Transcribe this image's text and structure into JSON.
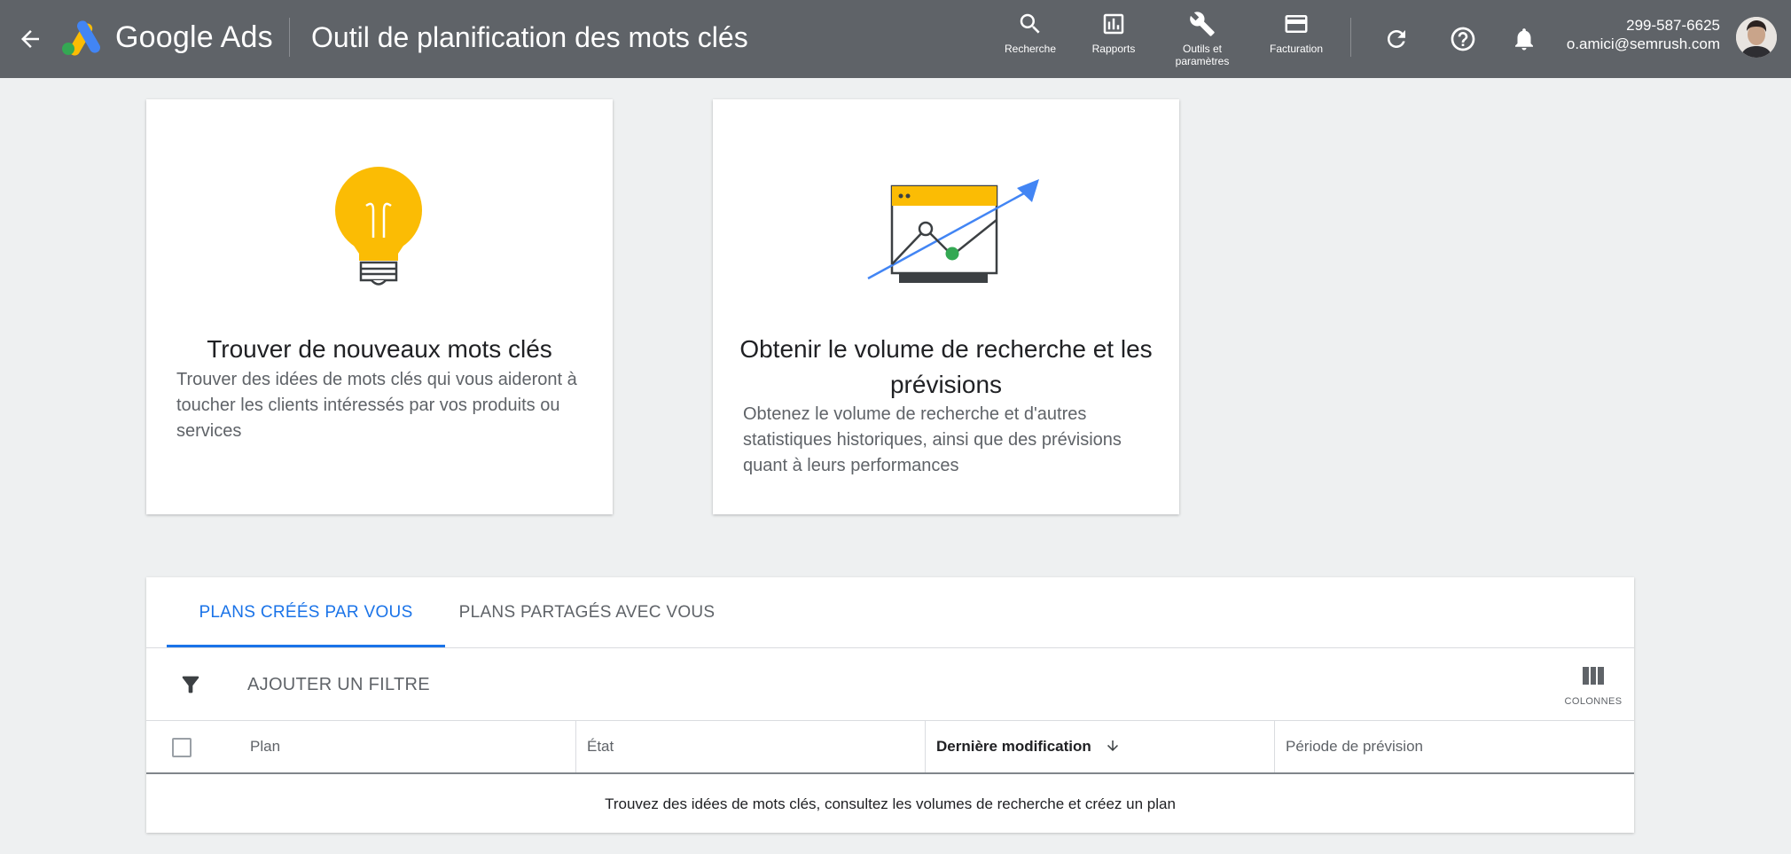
{
  "header": {
    "back_icon": "arrow-back-icon",
    "brand": "Google Ads",
    "title": "Outil de planification des mots clés",
    "nav": [
      {
        "label": "Recherche",
        "icon": "search-icon"
      },
      {
        "label": "Rapports",
        "icon": "reports-icon"
      },
      {
        "label_line1": "Outils et",
        "label_line2": "paramètres",
        "icon": "wrench-icon"
      },
      {
        "label": "Facturation",
        "icon": "credit-card-icon"
      }
    ],
    "refresh_icon": "refresh-icon",
    "help_icon": "help-icon",
    "notifications_icon": "bell-icon",
    "account": {
      "customer_id": "299-587-6625",
      "email": "o.amici@semrush.com"
    }
  },
  "cards": [
    {
      "title": "Trouver de nouveaux mots clés",
      "description": "Trouver des idées de mots clés qui vous aideront à toucher les clients intéressés par vos produits ou services",
      "icon": "lightbulb-icon"
    },
    {
      "title": "Obtenir le volume de recherche et les prévisions",
      "description": "Obtenez le volume de recherche et d'autres statistiques historiques, ainsi que des prévisions quant à leurs performances",
      "icon": "chart-trend-icon"
    }
  ],
  "plans": {
    "tabs": [
      {
        "label": "PLANS CRÉÉS PAR VOUS",
        "active": true
      },
      {
        "label": "PLANS PARTAGÉS AVEC VOUS",
        "active": false
      }
    ],
    "filter_label": "AJOUTER UN FILTRE",
    "columns_label": "COLONNES",
    "columns": [
      "Plan",
      "État",
      "Dernière modification",
      "Période de prévision"
    ],
    "sorted_column": "Dernière modification",
    "empty_message": "Trouvez des idées de mots clés, consultez les volumes de recherche et créez un plan"
  },
  "colors": {
    "header_bg": "#5f6368",
    "page_bg": "#eef0f1",
    "accent": "#1a73e8",
    "bulb_yellow": "#fbbc04",
    "trend_blue": "#4285f4",
    "point_green": "#34a853"
  }
}
